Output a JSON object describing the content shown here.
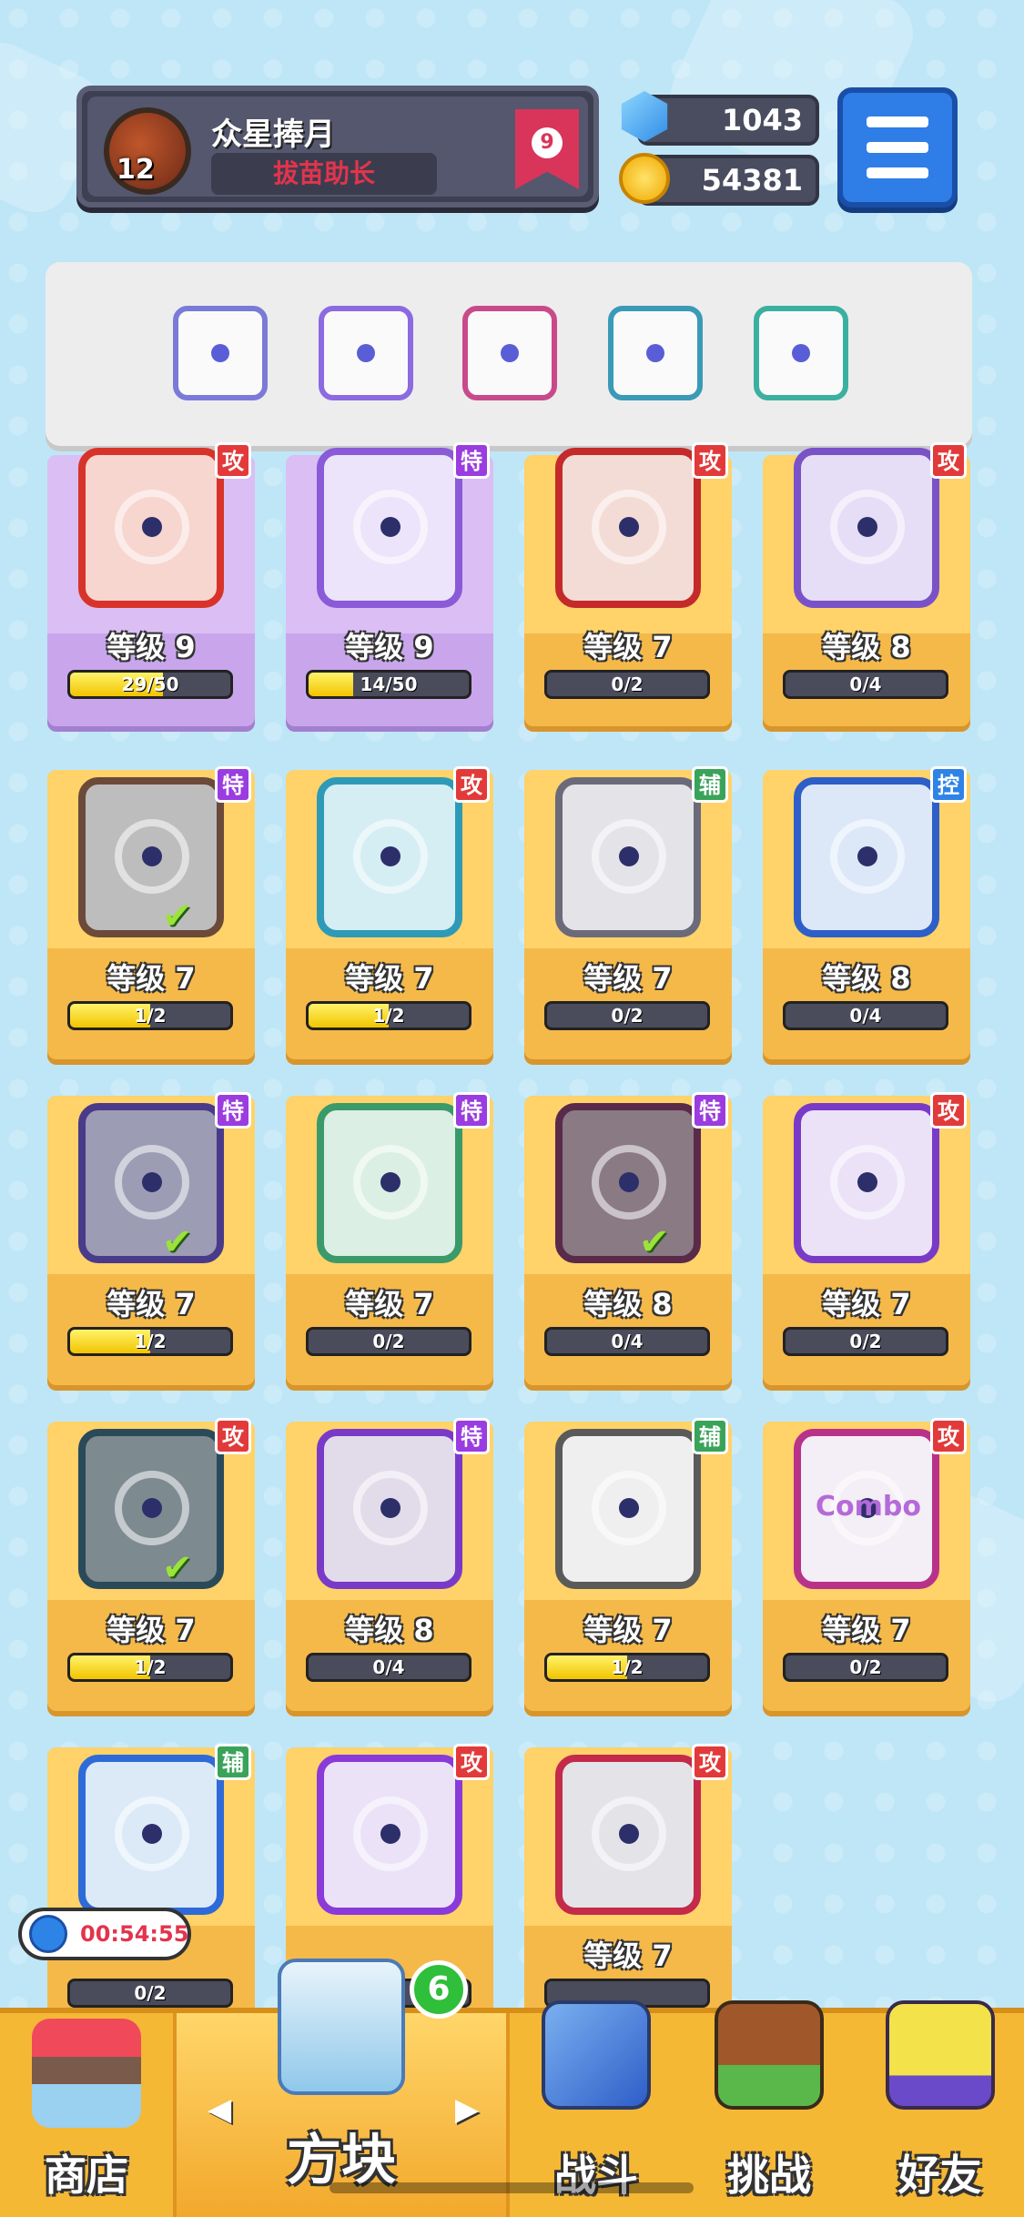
{
  "player": {
    "level": "12",
    "name": "众星捧月",
    "title": "拔苗助长",
    "rank": "9"
  },
  "currency": {
    "gems": "1043",
    "coins": "54381"
  },
  "equipped": [
    {
      "name": "infinity-icon",
      "color": "#7a7ad8"
    },
    {
      "name": "arrows-up-icon",
      "color": "#8c6ae0"
    },
    {
      "name": "sword-icon",
      "color": "#c94a8a"
    },
    {
      "name": "vortex-icon",
      "color": "#3a9ab8"
    },
    {
      "name": "hands-orb-icon",
      "color": "#3ab0a0"
    }
  ],
  "cards": [
    {
      "level": "等级 9",
      "progress": "29/50",
      "fill": 0.58,
      "tag": "攻",
      "tagType": "atk",
      "purple": true,
      "frame": "#d8332a",
      "bg": "#f7d6d0",
      "check": false
    },
    {
      "level": "等级 9",
      "progress": "14/50",
      "fill": 0.28,
      "tag": "特",
      "tagType": "spc",
      "purple": true,
      "frame": "#8a5ad8",
      "bg": "#ece4fa",
      "check": false
    },
    {
      "level": "等级 7",
      "progress": "0/2",
      "fill": 0,
      "tag": "攻",
      "tagType": "atk",
      "purple": false,
      "frame": "#c42a2a",
      "bg": "#f4dcd6",
      "check": false
    },
    {
      "level": "等级 8",
      "progress": "0/4",
      "fill": 0,
      "tag": "攻",
      "tagType": "atk",
      "purple": false,
      "frame": "#7a52c8",
      "bg": "#e6def6",
      "check": false
    },
    {
      "level": "等级 7",
      "progress": "1/2",
      "fill": 0.5,
      "tag": "特",
      "tagType": "spc",
      "purple": false,
      "frame": "#6b4a3a",
      "bg": "#bdbdbd",
      "check": true
    },
    {
      "level": "等级 7",
      "progress": "1/2",
      "fill": 0.5,
      "tag": "攻",
      "tagType": "atk",
      "purple": false,
      "frame": "#2e9ab8",
      "bg": "#d4eef4",
      "check": false
    },
    {
      "level": "等级 7",
      "progress": "0/2",
      "fill": 0,
      "tag": "辅",
      "tagType": "sup",
      "purple": false,
      "frame": "#6a6a7a",
      "bg": "#e4e4e8",
      "check": false
    },
    {
      "level": "等级 8",
      "progress": "0/4",
      "fill": 0,
      "tag": "控",
      "tagType": "ctl",
      "purple": false,
      "frame": "#2e5ec8",
      "bg": "#dce8f8",
      "check": false
    },
    {
      "level": "等级 7",
      "progress": "1/2",
      "fill": 0.5,
      "tag": "特",
      "tagType": "spc",
      "purple": false,
      "frame": "#4a3a8a",
      "bg": "#9c9cb4",
      "check": true
    },
    {
      "level": "等级 7",
      "progress": "0/2",
      "fill": 0,
      "tag": "特",
      "tagType": "spc",
      "purple": false,
      "frame": "#3a9a6a",
      "bg": "#dcefe4",
      "check": false
    },
    {
      "level": "等级 8",
      "progress": "0/4",
      "fill": 0,
      "tag": "特",
      "tagType": "spc",
      "purple": false,
      "frame": "#5a2a4a",
      "bg": "#8a7a84",
      "check": true
    },
    {
      "level": "等级 7",
      "progress": "0/2",
      "fill": 0,
      "tag": "攻",
      "tagType": "atk",
      "purple": false,
      "frame": "#7a3ac8",
      "bg": "#ece2f8",
      "check": false
    },
    {
      "level": "等级 7",
      "progress": "1/2",
      "fill": 0.5,
      "tag": "攻",
      "tagType": "atk",
      "purple": false,
      "frame": "#2a4a5a",
      "bg": "#7d8a90",
      "check": true
    },
    {
      "level": "等级 8",
      "progress": "0/4",
      "fill": 0,
      "tag": "特",
      "tagType": "spc",
      "purple": false,
      "frame": "#7a3ac8",
      "bg": "#e2dcea",
      "check": false
    },
    {
      "level": "等级 7",
      "progress": "1/2",
      "fill": 0.5,
      "tag": "辅",
      "tagType": "sup",
      "purple": false,
      "frame": "#5a5a5a",
      "bg": "#efefef",
      "check": false
    },
    {
      "level": "等级 7",
      "progress": "0/2",
      "fill": 0,
      "tag": "攻",
      "tagType": "atk",
      "purple": false,
      "frame": "#b8328a",
      "bg": "#f4eef6",
      "check": false
    },
    {
      "level": "",
      "progress": "0/2",
      "fill": 0,
      "tag": "辅",
      "tagType": "sup",
      "purple": false,
      "frame": "#2e6ad8",
      "bg": "#dceaf8",
      "check": false
    },
    {
      "level": "",
      "progress": "",
      "fill": 0,
      "tag": "攻",
      "tagType": "atk",
      "purple": false,
      "frame": "#8a3ad8",
      "bg": "#ece2f8",
      "check": false
    },
    {
      "level": "等级 7",
      "progress": "",
      "fill": 0,
      "tag": "攻",
      "tagType": "atk",
      "purple": false,
      "frame": "#c42a4a",
      "bg": "#e4e4e8",
      "check": false
    }
  ],
  "combo_text": "Combo",
  "timer": "00:54:55",
  "nav": {
    "shop": "商店",
    "blocks": "方块",
    "battle": "战斗",
    "challenge": "挑战",
    "friends": "好友",
    "blocks_badge": "6"
  }
}
